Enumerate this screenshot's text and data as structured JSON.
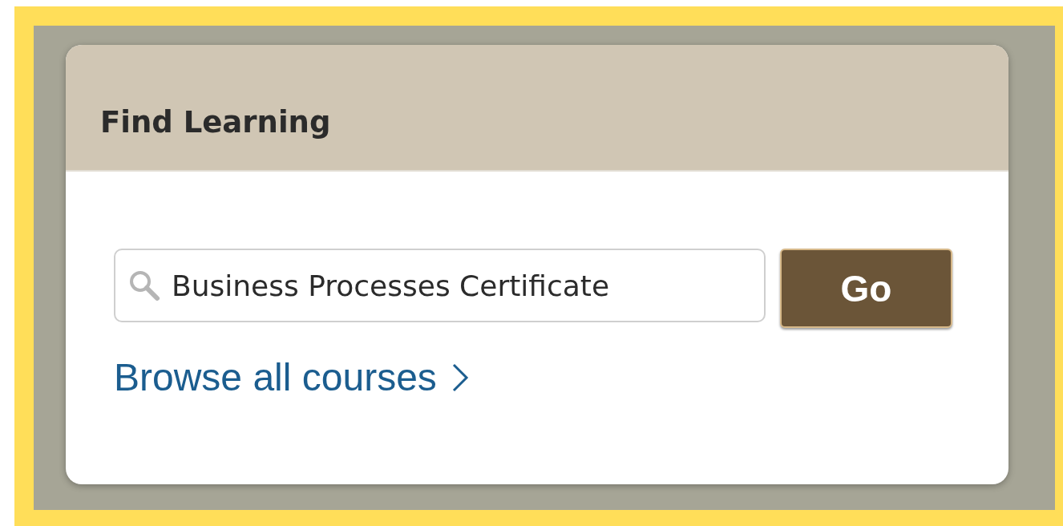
{
  "card": {
    "title": "Find Learning"
  },
  "search": {
    "value": "Business Processes Certificate"
  },
  "go_button": {
    "label": "Go"
  },
  "browse_link": {
    "label": "Browse all courses"
  }
}
